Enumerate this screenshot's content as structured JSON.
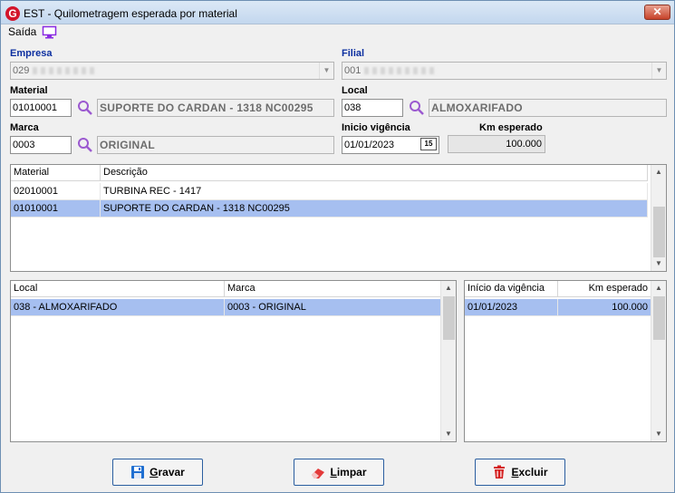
{
  "window": {
    "title": "EST - Quilometragem esperada por material",
    "close_glyph": "✕"
  },
  "menu": {
    "saida": "Saída"
  },
  "form": {
    "empresa": {
      "label": "Empresa",
      "value": "029"
    },
    "filial": {
      "label": "Filial",
      "value": "001"
    },
    "material": {
      "label": "Material",
      "code": "01010001",
      "description": "SUPORTE DO CARDAN - 1318 NC00295"
    },
    "local": {
      "label": "Local",
      "code": "038",
      "description": "ALMOXARIFADO"
    },
    "marca": {
      "label": "Marca",
      "code": "0003",
      "description": "ORIGINAL"
    },
    "inicio_vigencia": {
      "label": "Inicio vigência",
      "value": "01/01/2023",
      "calendar_glyph": "15"
    },
    "km_esperado": {
      "label": "Km esperado",
      "value": "100.000"
    }
  },
  "materials_grid": {
    "headers": [
      "Material",
      "Descrição"
    ],
    "rows": [
      {
        "material": "02010001",
        "descricao": "TURBINA REC - 1417",
        "selected": false
      },
      {
        "material": "01010001",
        "descricao": "SUPORTE DO CARDAN - 1318 NC00295",
        "selected": true
      }
    ]
  },
  "local_grid": {
    "headers": [
      "Local",
      "Marca"
    ],
    "rows": [
      {
        "local": "038 - ALMOXARIFADO",
        "marca": "0003 - ORIGINAL",
        "selected": true
      }
    ]
  },
  "vigencia_grid": {
    "headers": [
      "Início da vigência",
      "Km esperado"
    ],
    "rows": [
      {
        "inicio": "01/01/2023",
        "km": "100.000",
        "selected": true
      }
    ]
  },
  "buttons": {
    "gravar": {
      "mnemonic": "G",
      "rest": "ravar"
    },
    "limpar": {
      "mnemonic": "L",
      "rest": "impar"
    },
    "excluir": {
      "mnemonic": "E",
      "rest": "xcluir"
    }
  },
  "icons": [
    "app-logo-icon",
    "close-icon",
    "monitor-icon",
    "search-icon",
    "calendar-icon",
    "save-icon",
    "eraser-icon",
    "trash-icon",
    "combo-arrow-icon",
    "scroll-up-icon",
    "scroll-down-icon"
  ],
  "colors": {
    "label_blue": "#0c2fa0",
    "selection": "#a6bff0",
    "close_red": "#c7432a",
    "brand_red": "#d3142a"
  }
}
